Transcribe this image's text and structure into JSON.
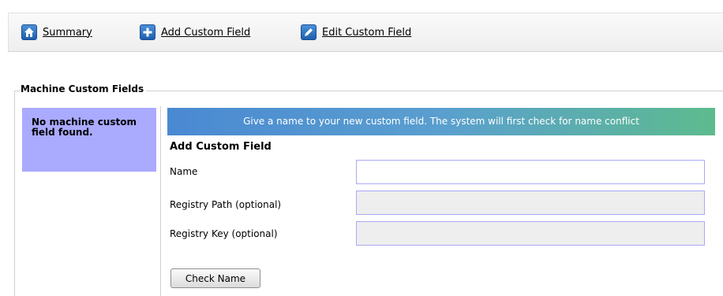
{
  "toolbar": {
    "items": [
      {
        "label": "Summary",
        "icon": "home-icon"
      },
      {
        "label": "Add Custom Field",
        "icon": "plus-icon"
      },
      {
        "label": "Edit Custom Field",
        "icon": "pencil-icon"
      }
    ]
  },
  "panel": {
    "legend": "Machine Custom Fields",
    "empty_message": "No machine custom field found."
  },
  "form": {
    "banner": "Give a name to your new custom field. The system will first check for name conflict",
    "title": "Add Custom Field",
    "fields": [
      {
        "label": "Name",
        "value": "",
        "disabled": false
      },
      {
        "label": "Registry Path (optional)",
        "value": "",
        "disabled": true
      },
      {
        "label": "Registry Key (optional)",
        "value": "",
        "disabled": true
      }
    ],
    "check_button": "Check Name"
  },
  "colors": {
    "empty_panel_bg": "#aaaaff",
    "banner_start": "#4a89d2",
    "banner_end": "#5dbb8e",
    "icon_blue": "#2c6fc0"
  }
}
